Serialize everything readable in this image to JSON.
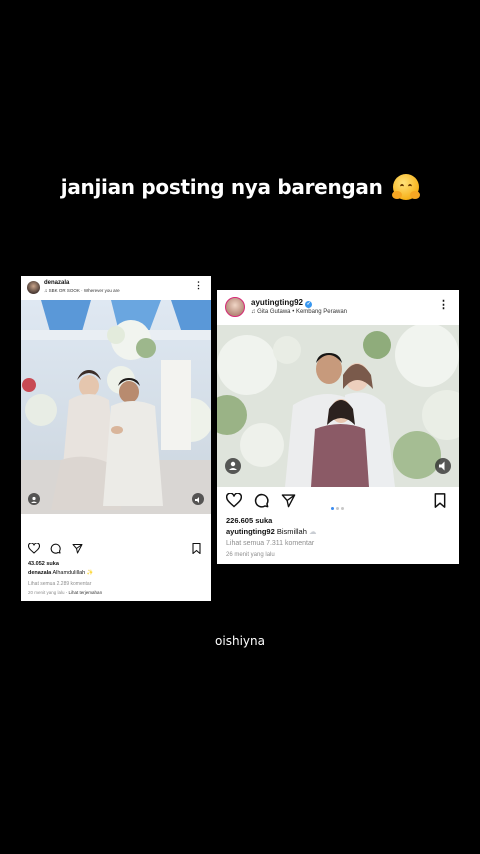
{
  "caption": "janjian posting nya barengan",
  "caption_emoji": "hugging-face-emoji",
  "watermark": "oishiyna",
  "left_post": {
    "username": "denazala",
    "music": "SBK OR SOOK · Wherever you are",
    "likes": "43.052 suka",
    "caption_user": "denazala",
    "caption_text": "Alhamdulillah",
    "comments": "Lihat semua 2.289 komentar",
    "time": "20 menit yang lalu",
    "translate": "· Lihat terjemahan"
  },
  "right_post": {
    "username": "ayutingting92",
    "music": "Gita Gutawa • Kembang Perawan",
    "likes": "226.605 suka",
    "caption_user": "ayutingting92",
    "caption_text": "Bismillah",
    "comments": "Lihat semua 7.311 komentar",
    "time": "26 menit yang lalu"
  },
  "colors": {
    "verified": "#3897f0",
    "active_dot": "#3b8cf0"
  }
}
